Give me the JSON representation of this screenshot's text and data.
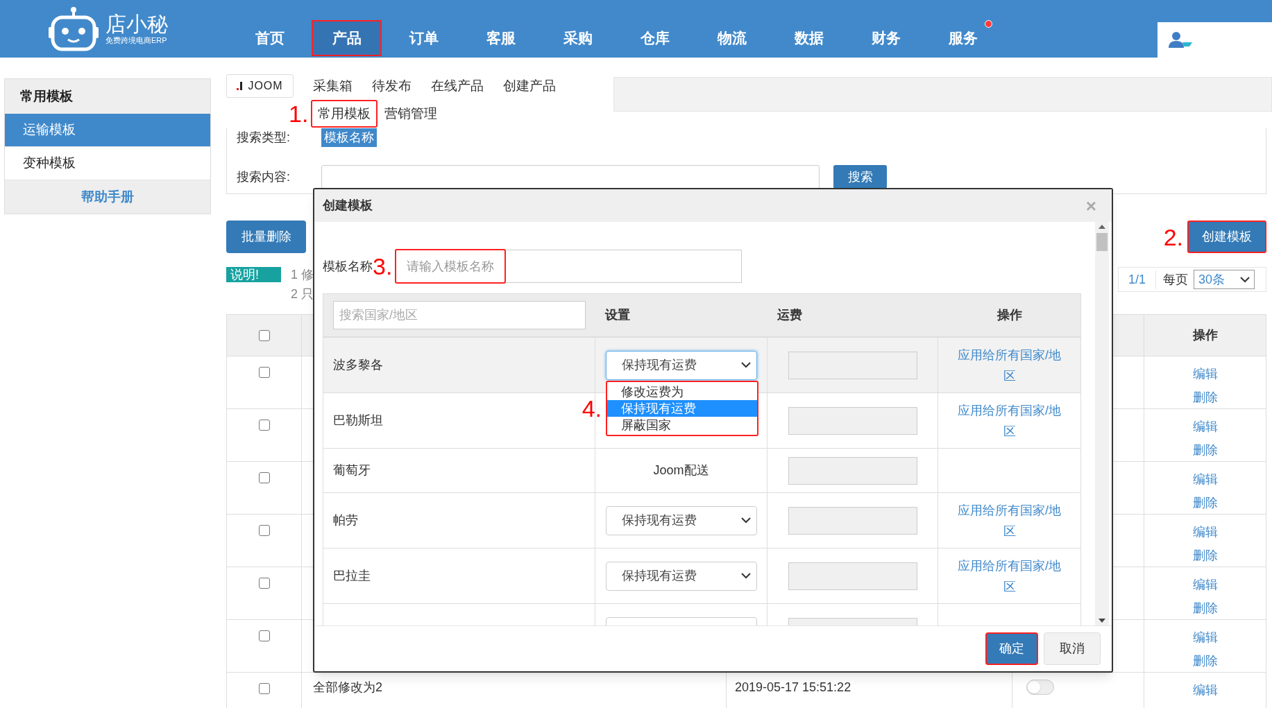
{
  "logo": {
    "name": "店小秘",
    "tagline": "免费跨境电商ERP"
  },
  "nav": [
    {
      "label": "首页",
      "selected": false,
      "highlighted": false,
      "badge": false
    },
    {
      "label": "产品",
      "selected": true,
      "highlighted": true,
      "badge": false
    },
    {
      "label": "订单",
      "selected": false,
      "highlighted": false,
      "badge": false
    },
    {
      "label": "客服",
      "selected": false,
      "highlighted": false,
      "badge": false
    },
    {
      "label": "采购",
      "selected": false,
      "highlighted": false,
      "badge": false
    },
    {
      "label": "仓库",
      "selected": false,
      "highlighted": false,
      "badge": false
    },
    {
      "label": "物流",
      "selected": false,
      "highlighted": false,
      "badge": false
    },
    {
      "label": "数据",
      "selected": false,
      "highlighted": false,
      "badge": false
    },
    {
      "label": "财务",
      "selected": false,
      "highlighted": false,
      "badge": false
    },
    {
      "label": "服务",
      "selected": false,
      "highlighted": false,
      "badge": true
    }
  ],
  "sidebar": {
    "title": "常用模板",
    "items": [
      {
        "label": "运输模板",
        "selected": true
      },
      {
        "label": "变种模板",
        "selected": false
      }
    ],
    "help": "帮助手册"
  },
  "platform": "JOOM",
  "tabs": [
    {
      "label": "采集箱",
      "selected": false
    },
    {
      "label": "待发布",
      "selected": false
    },
    {
      "label": "在线产品",
      "selected": false
    },
    {
      "label": "创建产品",
      "selected": false
    }
  ],
  "subtabs": [
    {
      "label": "常用模板",
      "selected": true,
      "callout": "1."
    },
    {
      "label": "营销管理",
      "selected": false
    }
  ],
  "search": {
    "type_label": "搜索类型:",
    "type_value": "模板名称",
    "content_label": "搜索内容:",
    "button": "搜索"
  },
  "batch_delete": "批量删除",
  "create_button": {
    "label": "创建模板",
    "callout": "2."
  },
  "notice": {
    "tag": "说明!",
    "lines": [
      "1 修",
      "2 只"
    ]
  },
  "pagination": {
    "pages": "1/1",
    "per_page_label": "每页",
    "per_page": "30条"
  },
  "table": {
    "header_checked": false,
    "action_header": "操作",
    "rows": [
      {
        "checked": false,
        "actions": [
          "编辑",
          "删除"
        ]
      },
      {
        "checked": false,
        "actions": [
          "编辑",
          "删除"
        ]
      },
      {
        "checked": false,
        "actions": [
          "编辑",
          "删除"
        ]
      },
      {
        "checked": false,
        "actions": [
          "编辑",
          "删除"
        ]
      },
      {
        "checked": false,
        "actions": [
          "编辑",
          "删除"
        ]
      },
      {
        "checked": false,
        "actions": [
          "编辑",
          "删除"
        ]
      },
      {
        "checked": false,
        "name": "全部修改为2",
        "date": "2019-05-17 15:51:22",
        "enabled": false,
        "actions": [
          "编辑"
        ]
      }
    ]
  },
  "modal": {
    "title": "创建模板",
    "close": "×",
    "name_label": "模板名称",
    "name_placeholder": "请输入模板名称",
    "name_callout": "3.",
    "country_search_placeholder": "搜索国家/地区",
    "columns": [
      "设置",
      "运费",
      "操作"
    ],
    "rows": [
      {
        "country": "波多黎各",
        "kind": "select",
        "setting": "保持现有运费",
        "action": "应用给所有国家/地区",
        "hovered": true,
        "dropdown_open": true
      },
      {
        "country": "巴勒斯坦",
        "kind": "empty",
        "action": "应用给所有国家/地区",
        "hovered": false,
        "dropdown_open": false
      },
      {
        "country": "葡萄牙",
        "kind": "text",
        "setting": "Joom配送",
        "hovered": false,
        "dropdown_open": false
      },
      {
        "country": "帕劳",
        "kind": "select",
        "setting": "保持现有运费",
        "action": "应用给所有国家/地区",
        "hovered": false,
        "dropdown_open": false
      },
      {
        "country": "巴拉圭",
        "kind": "select",
        "setting": "保持现有运费",
        "action": "应用给所有国家/地区",
        "hovered": false,
        "dropdown_open": false
      },
      {
        "kind": "select",
        "hovered": false,
        "dropdown_open": false
      }
    ],
    "dropdown": {
      "callout": "4.",
      "options": [
        {
          "label": "修改运费为",
          "selected": false
        },
        {
          "label": "保持现有运费",
          "selected": true
        },
        {
          "label": "屏蔽国家",
          "selected": false
        }
      ]
    },
    "buttons": [
      {
        "label": "确定",
        "kind": "primary",
        "highlighted": true
      },
      {
        "label": "取消",
        "kind": "default",
        "highlighted": false
      }
    ]
  }
}
